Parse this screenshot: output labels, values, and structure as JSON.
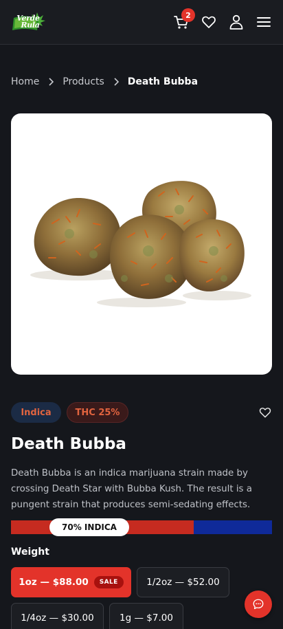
{
  "header": {
    "logo_text_line1": "Verde",
    "logo_text_line2": "Rula",
    "cart_count": "2",
    "icons": [
      "cart-icon",
      "heart-icon",
      "user-icon",
      "menu-icon"
    ]
  },
  "breadcrumb": {
    "items": [
      "Home",
      "Products",
      "Death Bubba"
    ]
  },
  "product": {
    "type_tag": "Indica",
    "thc_tag": "THC 25%",
    "name": "Death Bubba",
    "description": "Death Bubba is an indica marijuana strain made by crossing Death Star with Bubba Kush. The result is a pungent strain that produces semi-sedating effects.",
    "strain_label": "70% INDICA",
    "indica_fraction": 0.7
  },
  "weight": {
    "label": "Weight",
    "options": [
      {
        "label": "1oz — $88.00",
        "badge": "SALE",
        "selected": true
      },
      {
        "label": "1/2oz — $52.00",
        "selected": false
      },
      {
        "label": "1/4oz — $30.00",
        "selected": false
      },
      {
        "label": "1g — $7.00",
        "selected": false
      }
    ]
  },
  "colors": {
    "accent": "#e3332a",
    "indica_blue": "#0f2a99",
    "background": "#15171c"
  }
}
